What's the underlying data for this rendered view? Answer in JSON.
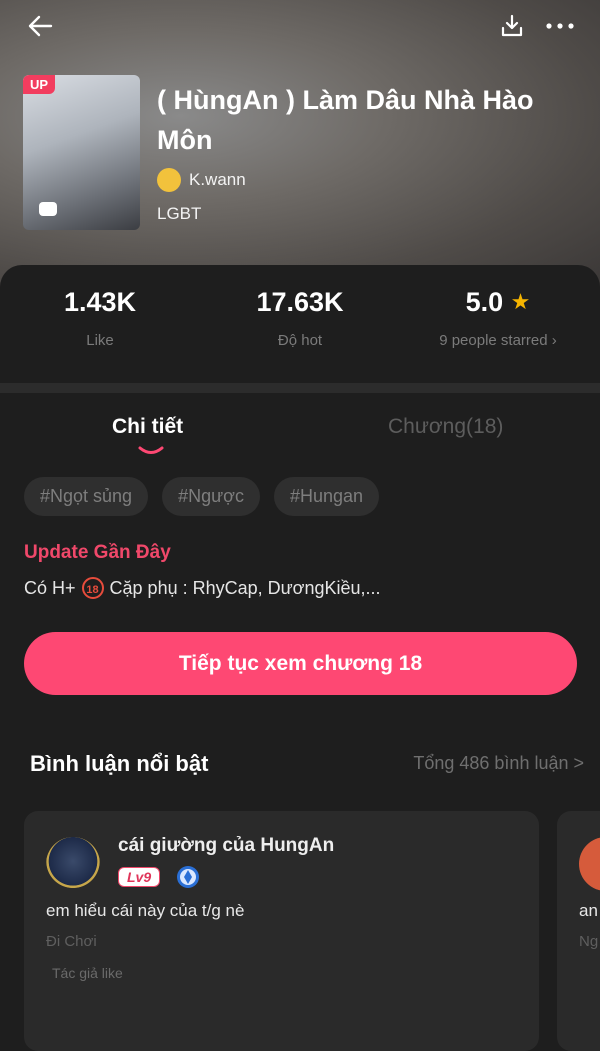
{
  "story": {
    "badge": "UP",
    "title": "( HùngAn ) Làm Dâu Nhà Hào Môn",
    "author": "K.wann",
    "genre": "LGBT"
  },
  "stats": [
    {
      "value": "1.43K",
      "label": "Like"
    },
    {
      "value": "17.63K",
      "label": "Độ hot"
    },
    {
      "value": "5.0",
      "label": "9 people starred",
      "chevron": "›"
    }
  ],
  "tabs": [
    {
      "label": "Chi tiết",
      "active": true
    },
    {
      "label": "Chương(18)",
      "active": false
    }
  ],
  "tags": [
    "#Ngọt sủng",
    "#Ngược",
    "#Hungan"
  ],
  "update": {
    "heading": "Update Gần Đây",
    "prefix": "Có H+",
    "age_badge": "18",
    "text": "Cặp phụ : RhyCap, DươngKiều,..."
  },
  "cta": {
    "label": "Tiếp tục xem chương 18"
  },
  "comments": {
    "heading": "Bình luận nổi bật",
    "total": "Tổng 486 bình luận >",
    "items": [
      {
        "user": "cái giường của HungAn",
        "level": "Lv9",
        "text": "em hiểu cái này của t/g nè",
        "chapter": "Đi Chơi",
        "author_like": "Tác giả like"
      },
      {
        "text": "an",
        "chapter": "Ng"
      }
    ]
  },
  "colors": {
    "accent": "#fe4873",
    "heading_pink": "#f0486a",
    "star": "#f5b400"
  },
  "icons": [
    "back-arrow-icon",
    "download-icon",
    "more-icon",
    "star-icon",
    "badge-icon"
  ]
}
